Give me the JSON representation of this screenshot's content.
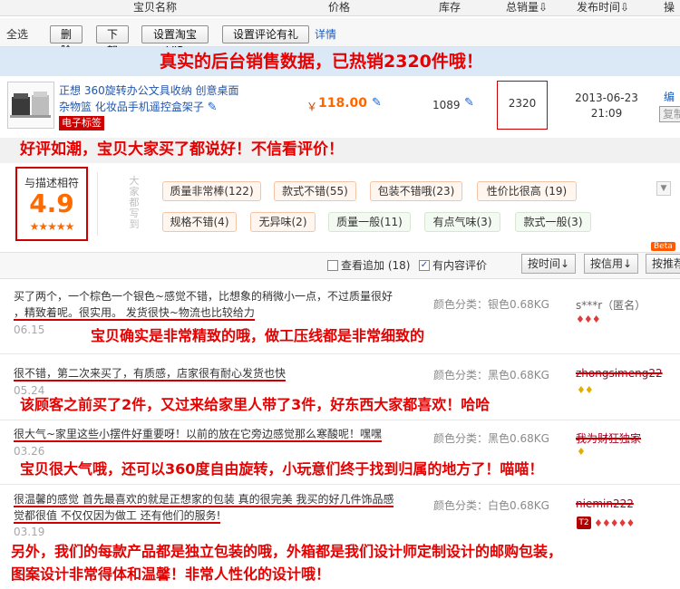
{
  "header": {
    "col_name": "宝贝名称",
    "col_price": "价格",
    "col_stock": "库存",
    "col_sales": "总销量",
    "col_time": "发布时间",
    "col_op": "操",
    "sales_arrow": "⇩",
    "time_arrow": "⇩"
  },
  "toolbar": {
    "select_all": "全选",
    "delete": "删 除",
    "offshelf": "下 架",
    "set_vip": "设置淘宝VIP",
    "set_reward": "设置评论有礼",
    "details": "详情"
  },
  "banner1": "真实的后台销售数据，已热销2320件哦！",
  "product": {
    "title": "正想 360旋转办公文具收纳 创意桌面杂物篮 化妆品手机遥控盒架子",
    "tag": "电子标签",
    "currency": "￥",
    "price": "118.00",
    "stock": "1089",
    "sales": "2320",
    "date": "2013-06-23",
    "time": "21:09",
    "edit": "编辑",
    "copy": "复制"
  },
  "banner2": "好评如潮，宝贝大家买了都说好！不信看评价！",
  "rating": {
    "label": "与描述相符",
    "score": "4.9",
    "stars": "★★★★★",
    "side_text": "大家都写到",
    "tags_row1": [
      "质量非常棒(122)",
      "款式不错(55)",
      "包装不错哦(23)",
      "性价比很高 (19)"
    ],
    "tags_row2": [
      "规格不错(4)",
      "无异味(2)",
      "质量一般(11)",
      "有点气味(3)",
      "款式一般(3)"
    ]
  },
  "filter": {
    "view_added": "查看追加 (18)",
    "with_content": "有内容评价",
    "sort_time": "按时间",
    "sort_credit": "按信用",
    "sort_default": "按推荐",
    "beta": "Beta"
  },
  "reviews": [
    {
      "text1": "买了两个，一个棕色一个银色~感觉不错，比想象的稍微小一点，不过质量很好",
      "text2": "，精致着呢。很实用。 发货很快~物流也比较给力",
      "date": "06.15",
      "color": "颜色分类：银色0.68KG",
      "user": "s***r（匿名）",
      "gems": "♦♦♦"
    },
    {
      "text1": "很不错，第二次来买了，有质感，店家很有耐心发货也快",
      "date": "05.24",
      "color": "颜色分类：黑色0.68KG",
      "user": "zhongsimeng22",
      "gems": "♦♦"
    },
    {
      "text1": "很大气~家里这些小摆件好重要呀！以前的放在它旁边感觉那么寒酸呢！嘿嘿",
      "date": "03.26",
      "color": "颜色分类：黑色0.68KG",
      "user": "我为财狂独家",
      "gems": "♦"
    },
    {
      "text1": "很温馨的感觉 首先最喜欢的就是正想家的包装 真的很完美 我买的好几件饰品感",
      "text2": "觉都很值 不仅仅因为做工 还有他们的服务!",
      "date": "03.19",
      "color": "颜色分类：白色0.68KG",
      "user": "niemin222",
      "badge": "T2",
      "gems": "♦♦♦♦♦"
    }
  ],
  "annotations": {
    "a1": "宝贝确实是非常精致的哦，做工压线都是非常细致的",
    "a2": "该顾客之前买了2件，又过来给家里人带了3件，好东西大家都喜欢！哈哈",
    "a3": "宝贝很大气哦，还可以360度自由旋转，小玩意们终于找到归属的地方了！喵喵！",
    "a4_line1": "另外，我们的每款产品都是独立包装的哦，外箱都是我们设计师定制设计的邮购包装，",
    "a4_line2": "图案设计非常得体和温馨！非常人性化的设计哦！"
  },
  "colors": {
    "annotation_red": "#e60000",
    "banner_blue": "#dbe9f7",
    "price_orange": "#ff6600",
    "link_blue": "#1a5fc0"
  }
}
